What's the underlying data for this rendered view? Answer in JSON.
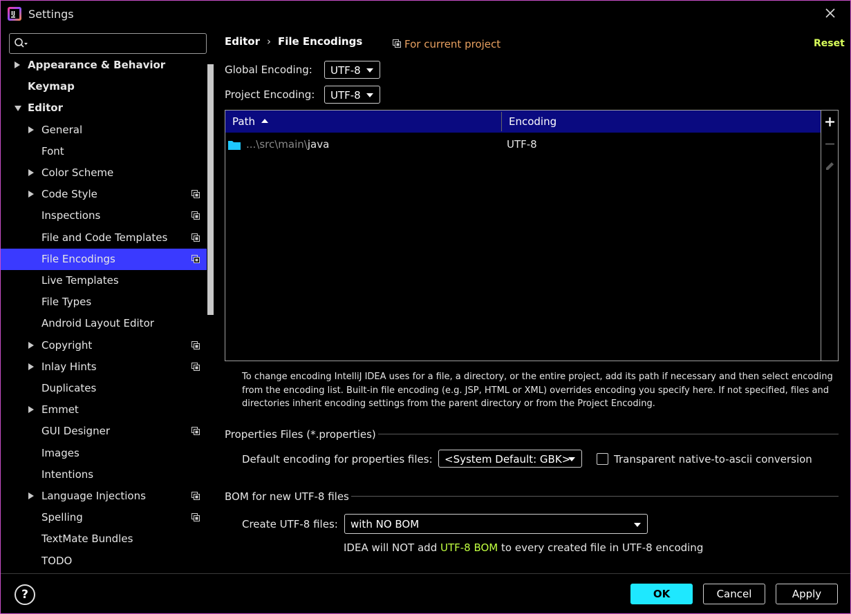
{
  "window": {
    "title": "Settings"
  },
  "search": {
    "placeholder": ""
  },
  "tree": {
    "items": [
      {
        "label": "Appearance & Behavior",
        "bold": true,
        "indent": 0,
        "arrow": "right",
        "project": false,
        "selected": false
      },
      {
        "label": "Keymap",
        "bold": true,
        "indent": 0,
        "arrow": "",
        "project": false,
        "selected": false
      },
      {
        "label": "Editor",
        "bold": true,
        "indent": 0,
        "arrow": "down",
        "project": false,
        "selected": false
      },
      {
        "label": "General",
        "bold": false,
        "indent": 1,
        "arrow": "right",
        "project": false,
        "selected": false
      },
      {
        "label": "Font",
        "bold": false,
        "indent": 1,
        "arrow": "",
        "project": false,
        "selected": false
      },
      {
        "label": "Color Scheme",
        "bold": false,
        "indent": 1,
        "arrow": "right",
        "project": false,
        "selected": false
      },
      {
        "label": "Code Style",
        "bold": false,
        "indent": 1,
        "arrow": "right",
        "project": true,
        "selected": false
      },
      {
        "label": "Inspections",
        "bold": false,
        "indent": 1,
        "arrow": "",
        "project": true,
        "selected": false
      },
      {
        "label": "File and Code Templates",
        "bold": false,
        "indent": 1,
        "arrow": "",
        "project": true,
        "selected": false
      },
      {
        "label": "File Encodings",
        "bold": false,
        "indent": 1,
        "arrow": "",
        "project": true,
        "selected": true
      },
      {
        "label": "Live Templates",
        "bold": false,
        "indent": 1,
        "arrow": "",
        "project": false,
        "selected": false
      },
      {
        "label": "File Types",
        "bold": false,
        "indent": 1,
        "arrow": "",
        "project": false,
        "selected": false
      },
      {
        "label": "Android Layout Editor",
        "bold": false,
        "indent": 1,
        "arrow": "",
        "project": false,
        "selected": false
      },
      {
        "label": "Copyright",
        "bold": false,
        "indent": 1,
        "arrow": "right",
        "project": true,
        "selected": false
      },
      {
        "label": "Inlay Hints",
        "bold": false,
        "indent": 1,
        "arrow": "right",
        "project": true,
        "selected": false
      },
      {
        "label": "Duplicates",
        "bold": false,
        "indent": 1,
        "arrow": "",
        "project": false,
        "selected": false
      },
      {
        "label": "Emmet",
        "bold": false,
        "indent": 1,
        "arrow": "right",
        "project": false,
        "selected": false
      },
      {
        "label": "GUI Designer",
        "bold": false,
        "indent": 1,
        "arrow": "",
        "project": true,
        "selected": false
      },
      {
        "label": "Images",
        "bold": false,
        "indent": 1,
        "arrow": "",
        "project": false,
        "selected": false
      },
      {
        "label": "Intentions",
        "bold": false,
        "indent": 1,
        "arrow": "",
        "project": false,
        "selected": false
      },
      {
        "label": "Language Injections",
        "bold": false,
        "indent": 1,
        "arrow": "right",
        "project": true,
        "selected": false
      },
      {
        "label": "Spelling",
        "bold": false,
        "indent": 1,
        "arrow": "",
        "project": true,
        "selected": false
      },
      {
        "label": "TextMate Bundles",
        "bold": false,
        "indent": 1,
        "arrow": "",
        "project": false,
        "selected": false
      },
      {
        "label": "TODO",
        "bold": false,
        "indent": 1,
        "arrow": "",
        "project": false,
        "selected": false
      }
    ]
  },
  "header": {
    "crumb_parent": "Editor",
    "crumb_sep": "›",
    "crumb_current": "File Encodings",
    "for_project": "For current project",
    "reset": "Reset"
  },
  "encodings": {
    "global_label": "Global Encoding:",
    "global_value": "UTF-8",
    "project_label": "Project Encoding:",
    "project_value": "UTF-8"
  },
  "table": {
    "col_path": "Path",
    "col_encoding": "Encoding",
    "rows": [
      {
        "path_prefix": "...\\src\\main\\",
        "path_name": "java",
        "encoding": "UTF-8"
      }
    ]
  },
  "help_text": "To change encoding IntelliJ IDEA uses for a file, a directory, or the entire project, add its path if necessary and then select encoding from the encoding list. Built-in file encoding (e.g. JSP, HTML or XML) overrides encoding you specify here. If not specified, files and directories inherit encoding settings from the parent directory or from the Project Encoding.",
  "properties": {
    "section_title": "Properties Files (*.properties)",
    "default_label": "Default encoding for properties files:",
    "default_value": "<System Default: GBK>",
    "transparent_label": "Transparent native-to-ascii conversion"
  },
  "bom": {
    "section_title": "BOM for new UTF-8 files",
    "create_label": "Create UTF-8 files:",
    "create_value": "with NO BOM",
    "note_before": "IDEA will NOT add ",
    "note_highlight": "UTF-8 BOM",
    "note_after": " to every created file in UTF-8 encoding"
  },
  "footer": {
    "help": "?",
    "ok": "OK",
    "cancel": "Cancel",
    "apply": "Apply"
  },
  "colors": {
    "selection": "#3a3aff",
    "table_header": "#0a0a80",
    "ok_button": "#1ee8ff",
    "reset_link": "#d8ff5a",
    "for_project": "#e8a060",
    "bom_highlight": "#c0ff40",
    "folder_icon": "#1ec8ff"
  }
}
